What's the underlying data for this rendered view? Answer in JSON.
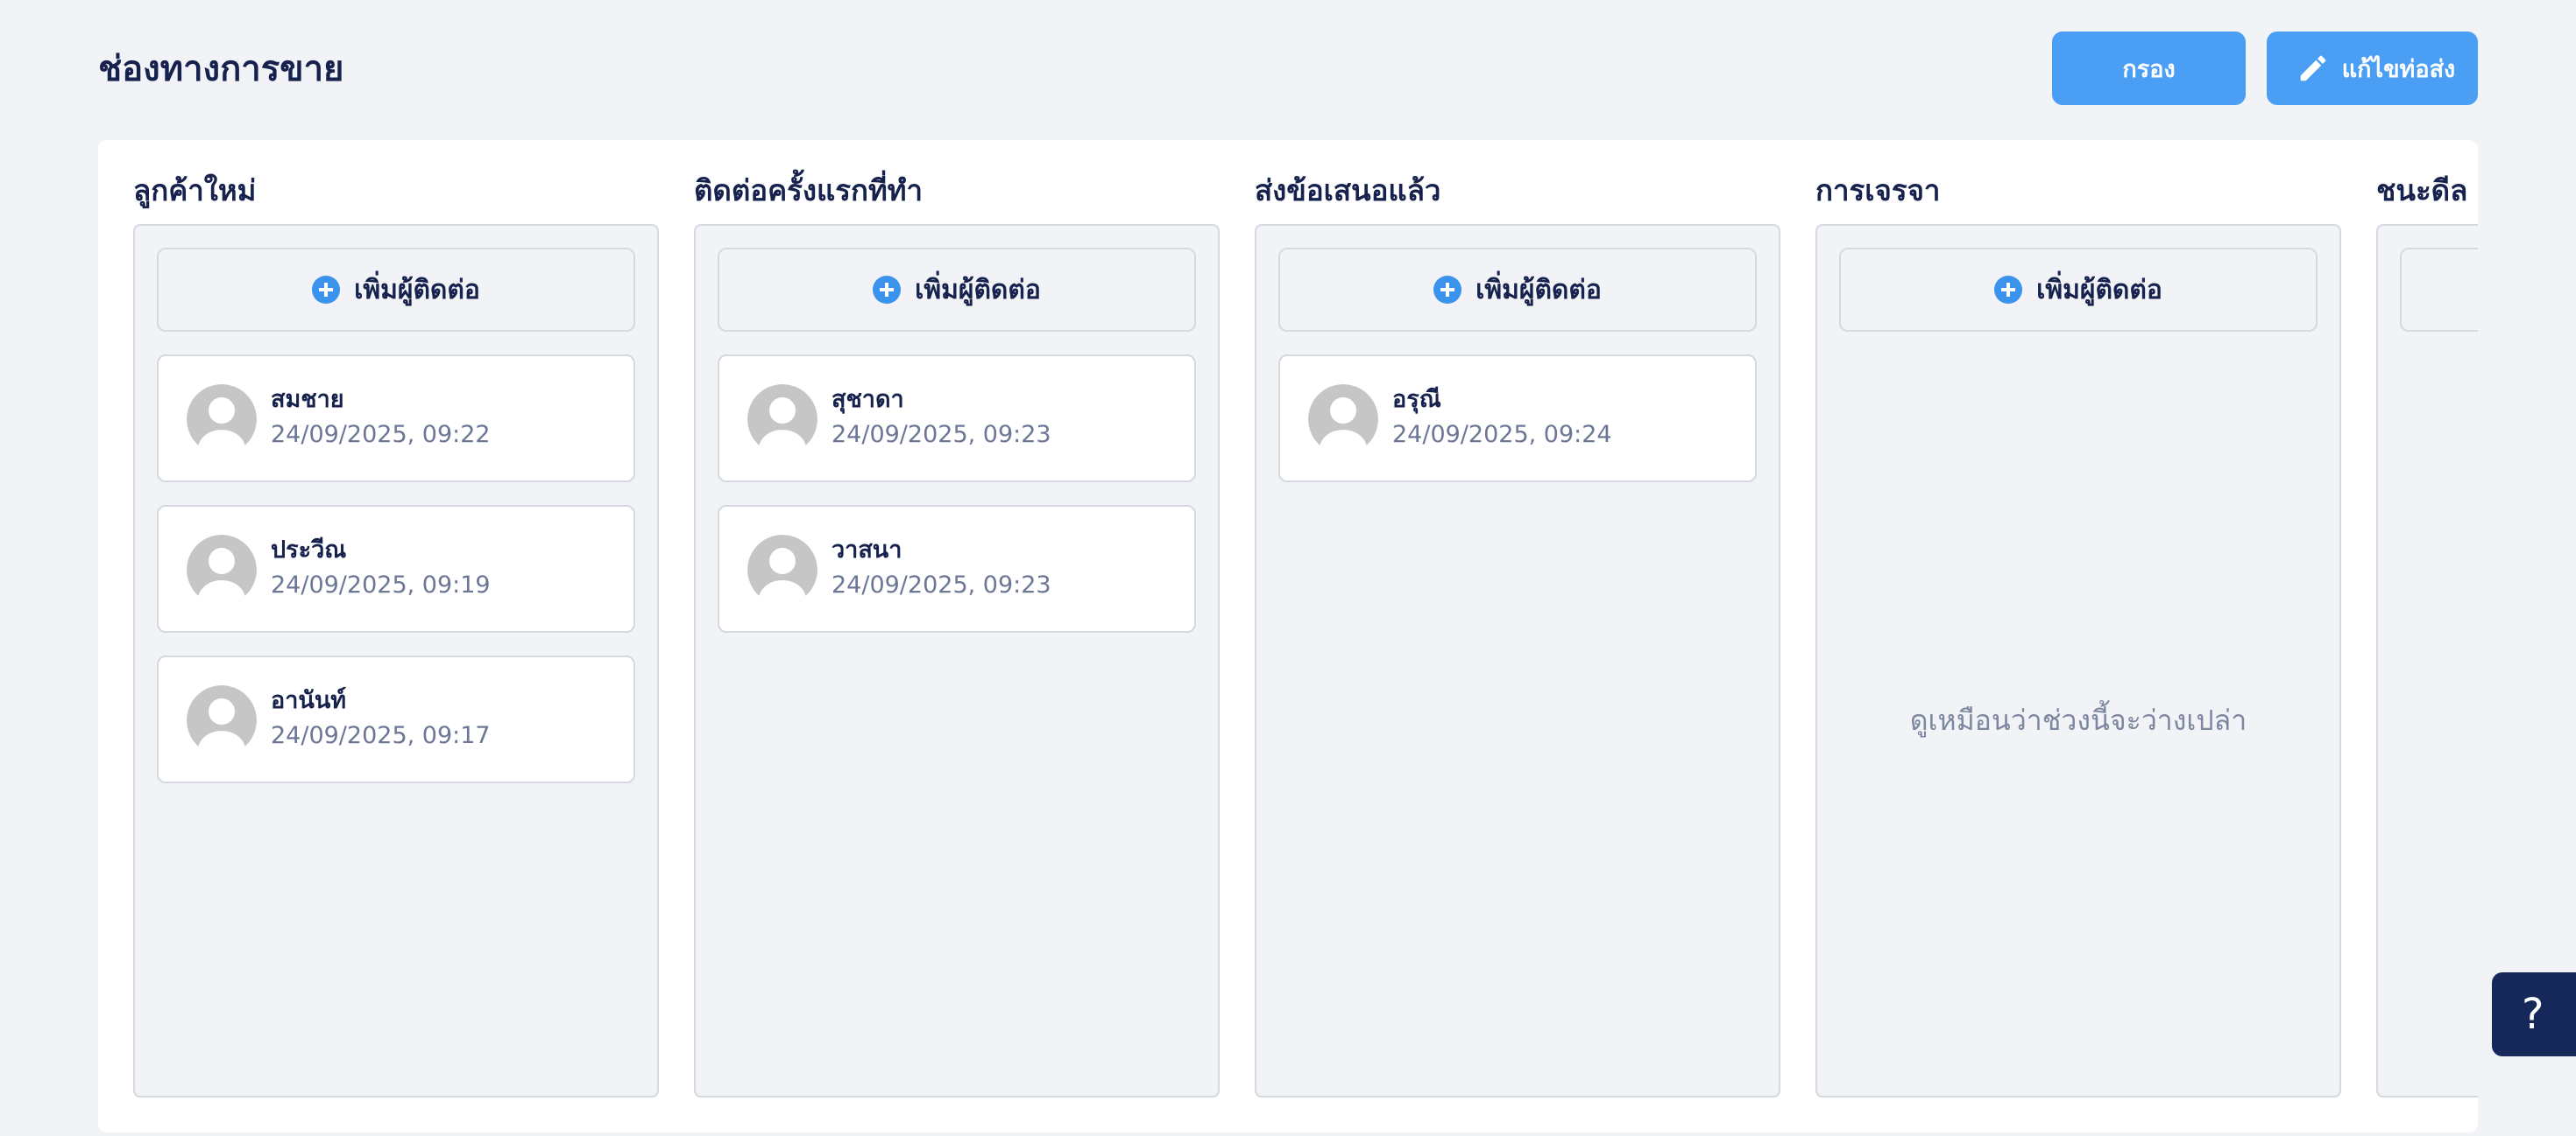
{
  "header": {
    "title": "ช่องทางการขาย",
    "filter_label": "กรอง",
    "edit_label": "แก้ไขท่อส่ง"
  },
  "columns": [
    {
      "title": "ลูกค้าใหม่",
      "add_label": "เพิ่มผู้ติดต่อ",
      "cards": [
        {
          "name": "สมชาย",
          "date": "24/09/2025, 09:22"
        },
        {
          "name": "ประวีณ",
          "date": "24/09/2025, 09:19"
        },
        {
          "name": "อานันท์",
          "date": "24/09/2025, 09:17"
        }
      ]
    },
    {
      "title": "ติดต่อครั้งแรกที่ทำ",
      "add_label": "เพิ่มผู้ติดต่อ",
      "cards": [
        {
          "name": "สุชาดา",
          "date": "24/09/2025, 09:23"
        },
        {
          "name": "วาสนา",
          "date": "24/09/2025, 09:23"
        }
      ]
    },
    {
      "title": "ส่งข้อเสนอแล้ว",
      "add_label": "เพิ่มผู้ติดต่อ",
      "cards": [
        {
          "name": "อรุณี",
          "date": "24/09/2025, 09:24"
        }
      ]
    },
    {
      "title": "การเจรจา",
      "add_label": "เพิ่มผู้ติดต่อ",
      "cards": [],
      "empty_text": "ดูเหมือนว่าช่วงนี้จะว่างเปล่า"
    },
    {
      "title": "ชนะดีล",
      "add_label": "",
      "cards": []
    }
  ],
  "help": {
    "label": "?"
  },
  "icons": {
    "edit": "pencil-icon",
    "add": "plus-circle-icon",
    "avatar": "user-avatar-placeholder"
  },
  "colors": {
    "primary": "#4a9ff5",
    "help_bg": "#16285a",
    "text_dark": "#16224d",
    "text_muted": "#6b7794",
    "bg": "#f1f3f7"
  }
}
